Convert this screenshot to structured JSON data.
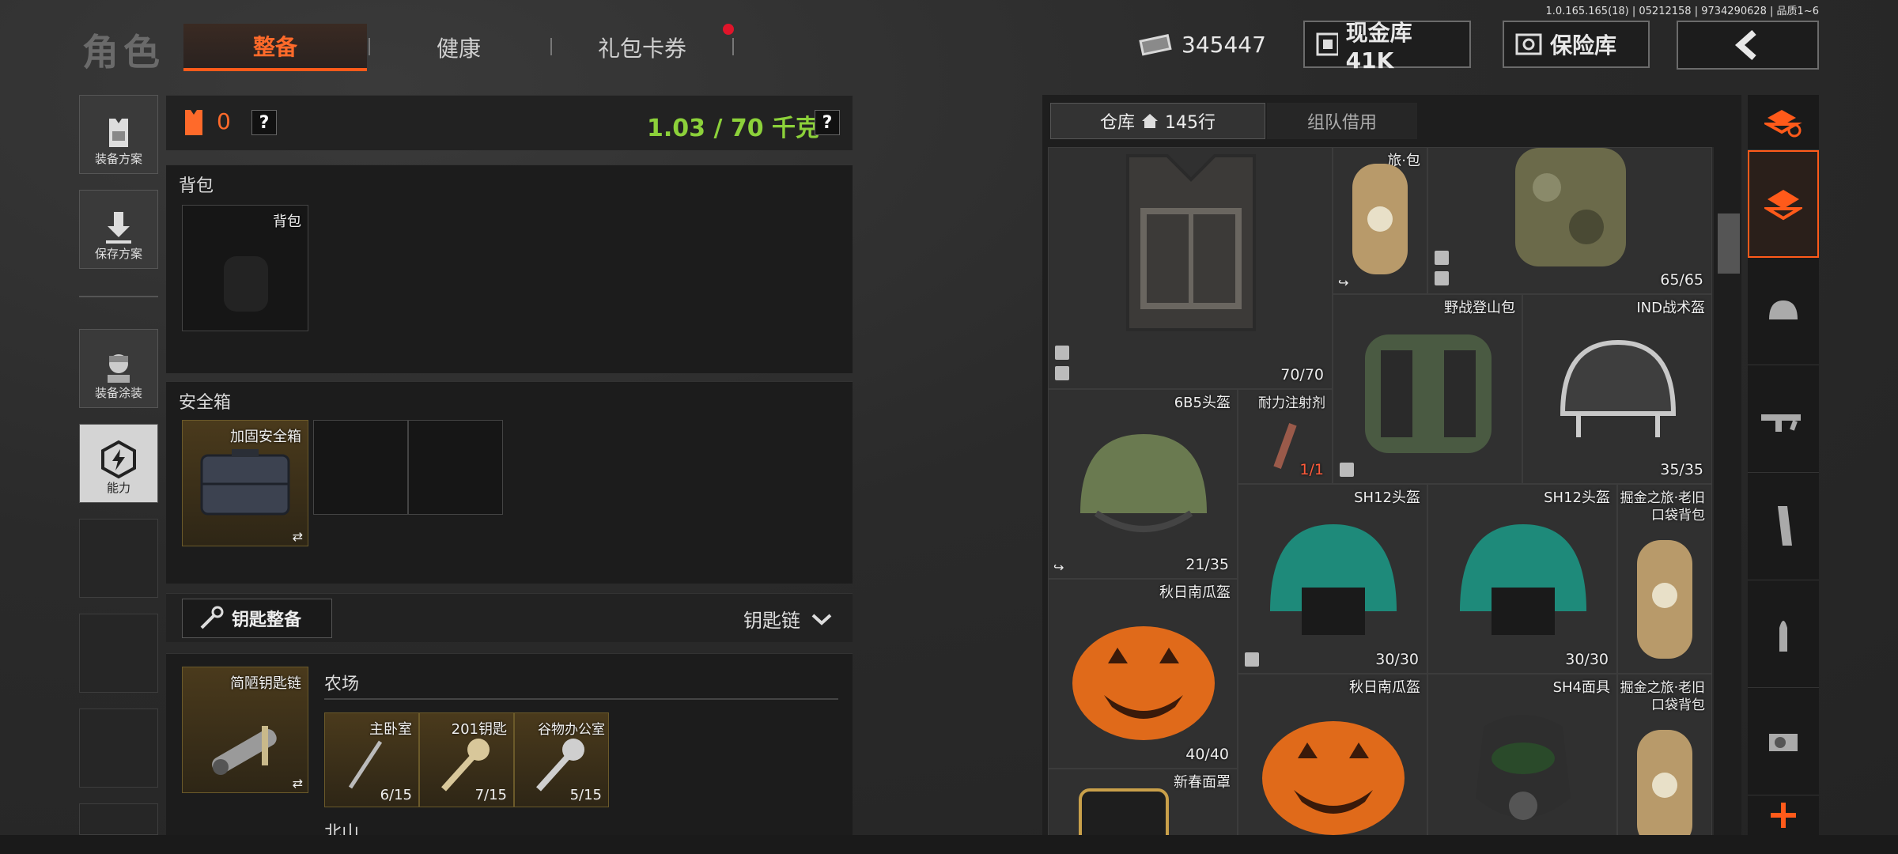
{
  "version": "1.0.165.165(18) | 05212158 | 9734290628 | 品质1~6",
  "header": {
    "title": "角色",
    "tabs": [
      {
        "label": "整备",
        "active": true
      },
      {
        "label": "健康",
        "active": false
      },
      {
        "label": "礼包卡券",
        "active": false,
        "badge": true
      }
    ],
    "money": "345447",
    "cash_vault": "现金库 41K",
    "safe": "保险库"
  },
  "sidebar": {
    "items": [
      {
        "label": "装备方案"
      },
      {
        "label": "保存方案"
      },
      {
        "label": "装备涂装"
      },
      {
        "label": "能力",
        "selected": true
      }
    ]
  },
  "loadout": {
    "armor_count": "0",
    "help": "?",
    "weight": "1.03 / 70 千克",
    "backpack": {
      "title": "背包",
      "slot_label": "背包"
    },
    "safebox": {
      "title": "安全箱",
      "item": "加固安全箱"
    },
    "keys": {
      "button": "钥匙整备",
      "dropdown": "钥匙链",
      "chain": "简陋钥匙链",
      "location": "农场",
      "next_location": "北山",
      "key_items": [
        {
          "name": "主卧室",
          "count": "6/15"
        },
        {
          "name": "201钥匙",
          "count": "7/15"
        },
        {
          "name": "谷物办公室",
          "count": "5/15"
        }
      ]
    }
  },
  "storage": {
    "tabs": [
      {
        "label": "仓库",
        "extra": "145行",
        "active": true
      },
      {
        "label": "组队借用",
        "active": false
      }
    ],
    "items": [
      {
        "name": "",
        "durability": "70/70"
      },
      {
        "name": "旅·包",
        "durability": ""
      },
      {
        "name": "",
        "durability": "65/65"
      },
      {
        "name": "野战登山包",
        "durability": ""
      },
      {
        "name": "IND战术盔",
        "durability": "35/35"
      },
      {
        "name": "6B5头盔",
        "durability": "21/35"
      },
      {
        "name": "耐力注射剂",
        "durability": "1/1"
      },
      {
        "name": "SH12头盔",
        "durability": "30/30"
      },
      {
        "name": "SH12头盔",
        "durability": "30/30"
      },
      {
        "name": "掘金之旅·老旧口袋背包",
        "durability": ""
      },
      {
        "name": "秋日南瓜盔",
        "durability": "40/40"
      },
      {
        "name": "秋日南瓜盔",
        "durability": ""
      },
      {
        "name": "SH4面具",
        "durability": ""
      },
      {
        "name": "掘金之旅·老旧口袋背包",
        "durability": ""
      },
      {
        "name": "新春面罩",
        "durability": ""
      }
    ]
  },
  "colors": {
    "accent": "#ff5a1a",
    "weight_green": "#8cd13a",
    "item_gold": "#6b5a2a"
  }
}
